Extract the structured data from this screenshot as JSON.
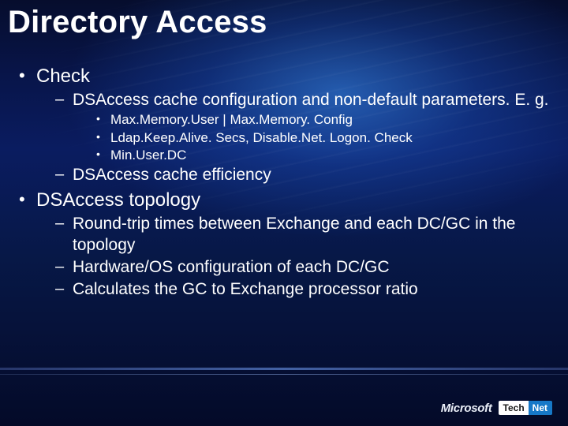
{
  "title": "Directory Access",
  "bullets": {
    "check": {
      "label": "Check",
      "sub": {
        "cacheConfig": "DSAccess cache configuration and non-default parameters. E. g.",
        "params": {
          "p1": "Max.Memory.User | Max.Memory. Config",
          "p2": "Ldap.Keep.Alive. Secs, Disable.Net. Logon. Check",
          "p3": "Min.User.DC"
        },
        "cacheEff": "DSAccess cache efficiency"
      }
    },
    "topology": {
      "label": "DSAccess topology",
      "sub": {
        "rtt": "Round-trip times between Exchange and each DC/GC in the topology",
        "hw": "Hardware/OS configuration of each DC/GC",
        "ratio": "Calculates the GC to Exchange processor ratio"
      }
    }
  },
  "footer": {
    "brand1a": "Microsoft",
    "tech": "Tech",
    "net": "Net"
  }
}
